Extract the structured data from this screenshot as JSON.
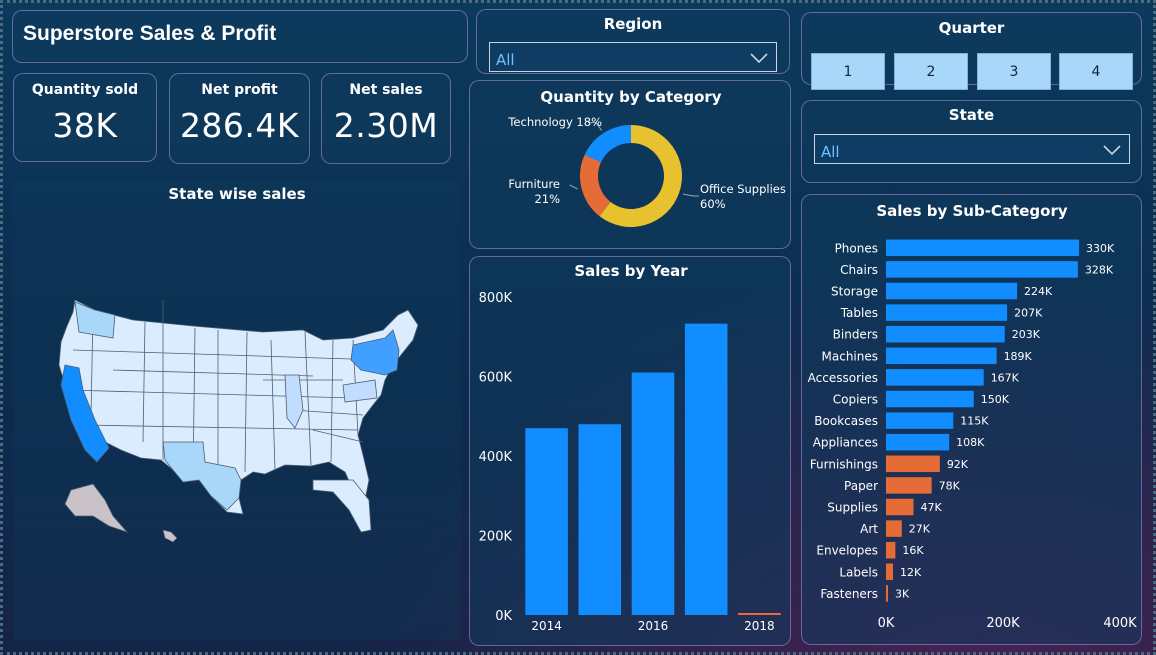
{
  "title": "Superstore Sales & Profit",
  "kpis": {
    "quantity": {
      "label": "Quantity sold",
      "value": "38K"
    },
    "profit": {
      "label": "Net profit",
      "value": "286.4K"
    },
    "sales": {
      "label": "Net sales",
      "value": "2.30M"
    }
  },
  "map": {
    "title": "State wise sales",
    "highlight_states": [
      "California",
      "New York",
      "Texas",
      "Washington",
      "Pennsylvania",
      "Illinois",
      "Ohio",
      "Michigan",
      "Florida"
    ]
  },
  "region": {
    "title": "Region",
    "selected": "All"
  },
  "quarter": {
    "title": "Quarter",
    "options": [
      "1",
      "2",
      "3",
      "4"
    ]
  },
  "state": {
    "title": "State",
    "selected": "All"
  },
  "colors": {
    "blue": "#118dff",
    "orange": "#e66c37",
    "yellow": "#e8c12f",
    "light_blue": "#a9d7fa"
  },
  "chart_data": [
    {
      "type": "pie",
      "title": "Quantity by Category",
      "labels": [
        "Office Supplies",
        "Furniture",
        "Technology"
      ],
      "values": [
        60,
        21,
        18
      ],
      "display_labels": [
        "Office Supplies\n60%",
        "Furniture\n21%",
        "Technology 18%"
      ],
      "colors": [
        "#e8c12f",
        "#e66c37",
        "#118dff"
      ],
      "donut": true
    },
    {
      "type": "bar",
      "title": "Sales by Year",
      "categories": [
        "2014",
        "2015",
        "2016",
        "2017",
        "2018"
      ],
      "values": [
        470000,
        480000,
        610000,
        733000,
        3000
      ],
      "bar_colors": [
        "#118dff",
        "#118dff",
        "#118dff",
        "#118dff",
        "#e66c37"
      ],
      "x_tick_labels": [
        "2014",
        "",
        "2016",
        "",
        "2018"
      ],
      "y_ticks": [
        "0K",
        "200K",
        "400K",
        "600K",
        "800K"
      ],
      "ylim": [
        0,
        800000
      ],
      "xlabel": "",
      "ylabel": ""
    },
    {
      "type": "bar",
      "orientation": "horizontal",
      "title": "Sales by Sub-Category",
      "categories": [
        "Phones",
        "Chairs",
        "Storage",
        "Tables",
        "Binders",
        "Machines",
        "Accessories",
        "Copiers",
        "Bookcases",
        "Appliances",
        "Furnishings",
        "Paper",
        "Supplies",
        "Art",
        "Envelopes",
        "Labels",
        "Fasteners"
      ],
      "values": [
        330000,
        328000,
        224000,
        207000,
        203000,
        189000,
        167000,
        150000,
        115000,
        108000,
        92000,
        78000,
        47000,
        27000,
        16000,
        12000,
        3000
      ],
      "data_labels": [
        "330K",
        "328K",
        "224K",
        "207K",
        "203K",
        "189K",
        "167K",
        "150K",
        "115K",
        "108K",
        "92K",
        "78K",
        "47K",
        "27K",
        "16K",
        "12K",
        "3K"
      ],
      "groups": [
        "Technology",
        "Furniture",
        "Office Supplies",
        "Furniture",
        "Office Supplies",
        "Technology",
        "Technology",
        "Technology",
        "Furniture",
        "Office Supplies",
        "Furniture",
        "Office Supplies",
        "Office Supplies",
        "Office Supplies",
        "Office Supplies",
        "Office Supplies",
        "Office Supplies"
      ],
      "bar_colors": [
        "#118dff",
        "#118dff",
        "#118dff",
        "#118dff",
        "#118dff",
        "#118dff",
        "#118dff",
        "#118dff",
        "#118dff",
        "#118dff",
        "#e66c37",
        "#e66c37",
        "#e66c37",
        "#e66c37",
        "#e66c37",
        "#e66c37",
        "#e66c37"
      ],
      "x_ticks": [
        "0K",
        "200K",
        "400K"
      ],
      "xlim": [
        0,
        400000
      ],
      "xlabel": "",
      "ylabel": ""
    }
  ]
}
